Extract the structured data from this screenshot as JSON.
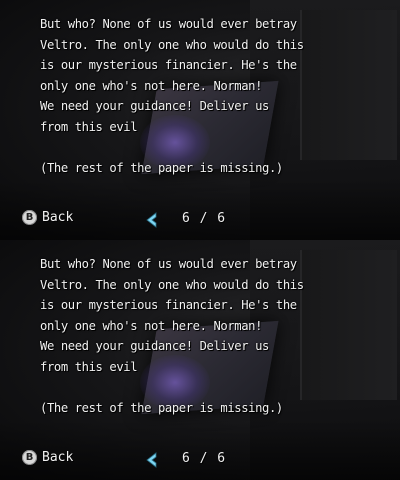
{
  "screens": [
    {
      "lines": [
        "But who? None of us would ever betray",
        "Veltro. The only one who would do this",
        "is our mysterious financier. He's the",
        "only one who's not here. Norman!",
        "We need your guidance! Deliver us",
        "from this evil",
        "",
        "(The rest of the paper is missing.)"
      ],
      "footer": {
        "button_glyph": "B",
        "back_label": "Back",
        "prev_icon": "chevron-left-icon",
        "page": "6 / 6"
      }
    },
    {
      "lines": [
        "But who? None of us would ever betray",
        "Veltro. The only one who would do this",
        "is our mysterious financier. He's the",
        "only one who's not here. Norman!",
        "We need your guidance! Deliver us",
        "from this evil",
        "",
        "(The rest of the paper is missing.)"
      ],
      "footer": {
        "button_glyph": "B",
        "back_label": "Back",
        "prev_icon": "chevron-left-icon",
        "page": "6 / 6"
      }
    }
  ],
  "colors": {
    "text": "#f2f2f2",
    "arrow": "#7fd6f2",
    "glow": "#6a50b4"
  }
}
